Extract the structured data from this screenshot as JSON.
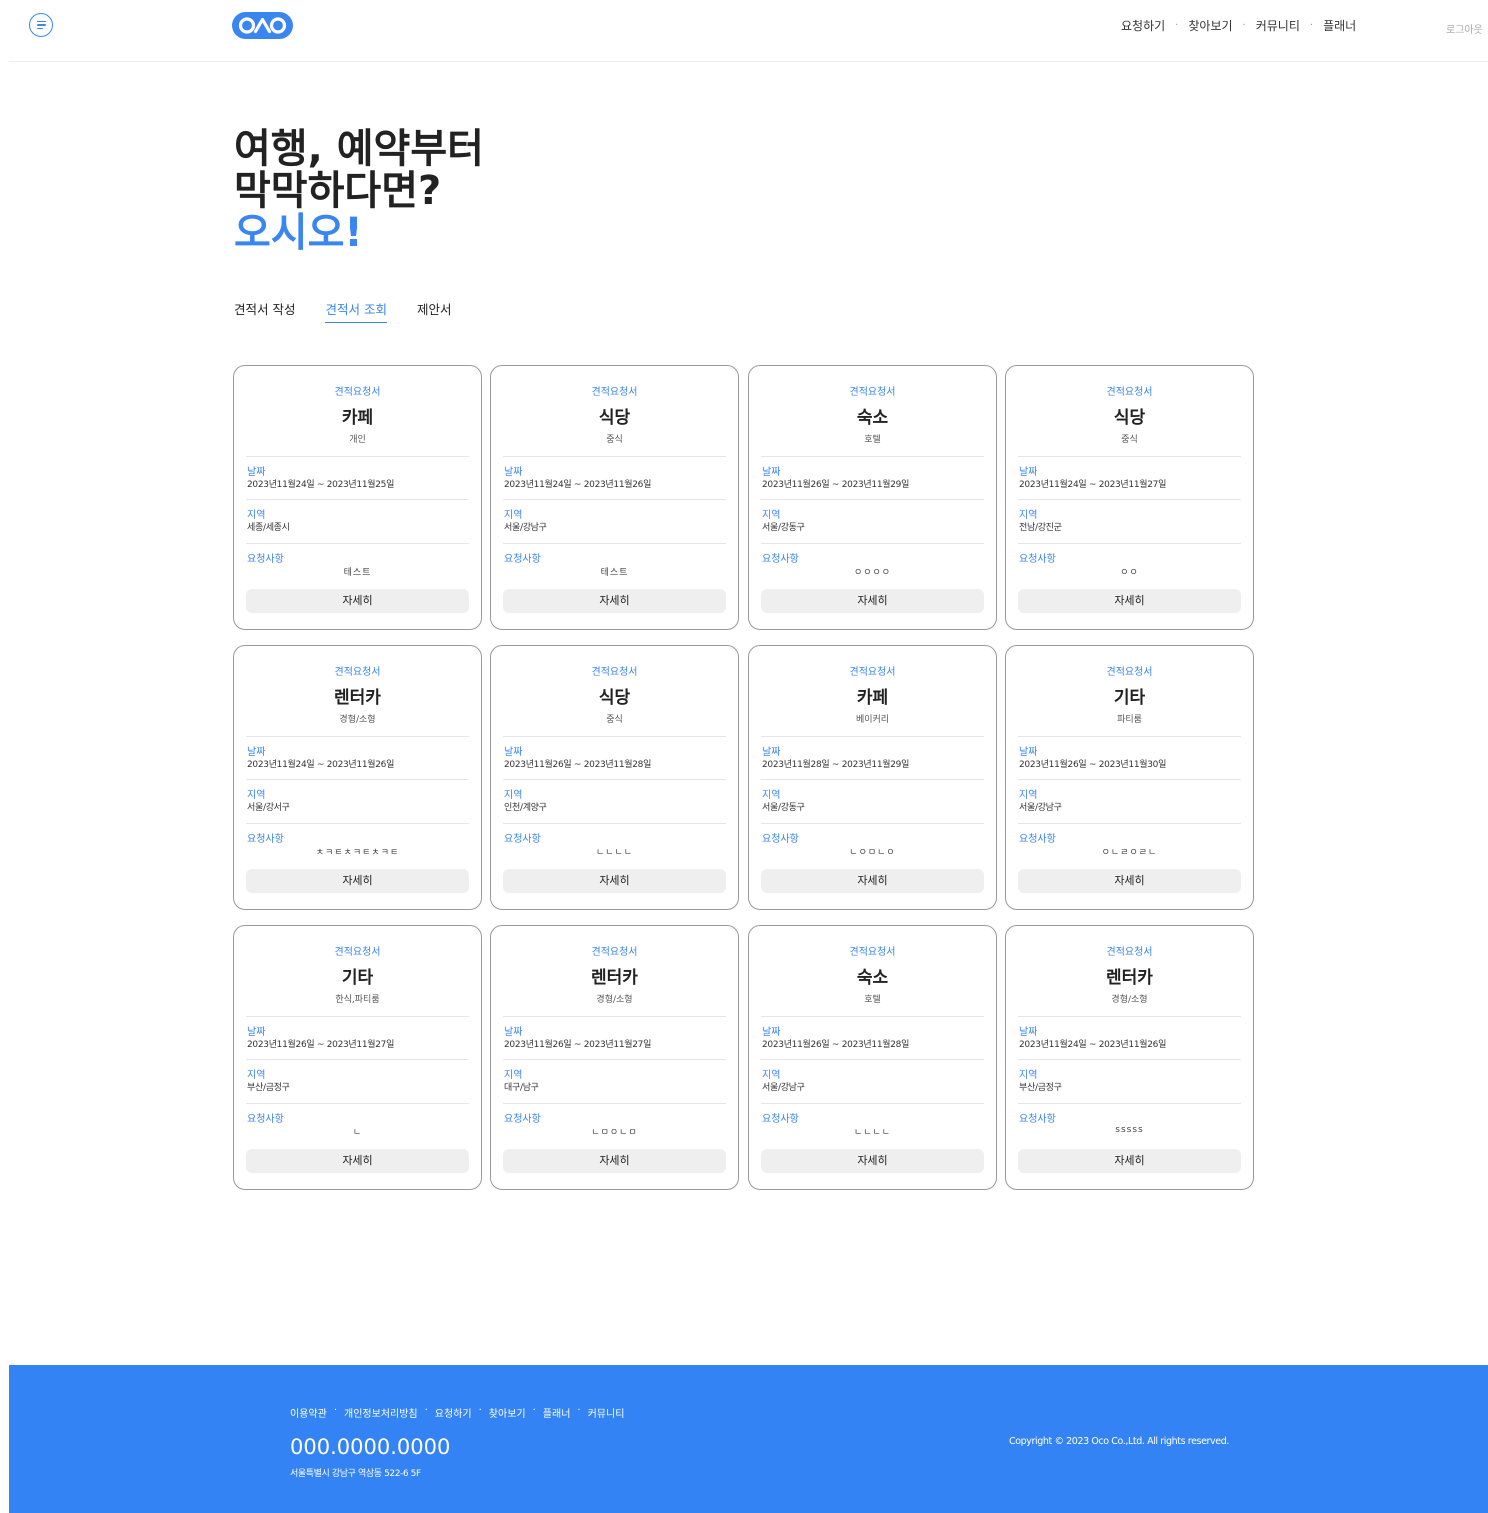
{
  "header": {
    "nav": [
      "요청하기",
      "찾아보기",
      "커뮤니티",
      "플래너"
    ],
    "nav_separator": "·",
    "logout": "로그아웃"
  },
  "hero": {
    "line1": "여행, 예약부터",
    "line2": "막막하다면?",
    "line3": "오시오!"
  },
  "tabs": [
    {
      "label": "견적서 작성",
      "active": false
    },
    {
      "label": "견적서 조회",
      "active": true
    },
    {
      "label": "제안서",
      "active": false
    }
  ],
  "card_labels": {
    "badge": "견적요청서",
    "date": "날짜",
    "region": "지역",
    "request": "요청사항",
    "button": "자세히"
  },
  "cards": [
    {
      "category": "카페",
      "sub": "개인",
      "date": "2023년11월24일 ~ 2023년11월25일",
      "region": "세종/세종시",
      "request": "테스트"
    },
    {
      "category": "식당",
      "sub": "중식",
      "date": "2023년11월24일 ~ 2023년11월26일",
      "region": "서울/강남구",
      "request": "테스트"
    },
    {
      "category": "숙소",
      "sub": "호텔",
      "date": "2023년11월26일 ~ 2023년11월29일",
      "region": "서울/강동구",
      "request": "ㅇㅇㅇㅇ"
    },
    {
      "category": "식당",
      "sub": "중식",
      "date": "2023년11월24일 ~ 2023년11월27일",
      "region": "전남/강진군",
      "request": "ㅇㅇ"
    },
    {
      "category": "렌터카",
      "sub": "경형/소형",
      "date": "2023년11월24일 ~ 2023년11월26일",
      "region": "서울/강서구",
      "request": "ㅊㅋㅌㅊㅋㅌㅊㅋㅌ"
    },
    {
      "category": "식당",
      "sub": "중식",
      "date": "2023년11월26일 ~ 2023년11월28일",
      "region": "인천/계양구",
      "request": "ㄴㄴㄴㄴ"
    },
    {
      "category": "카페",
      "sub": "베이커리",
      "date": "2023년11월28일 ~ 2023년11월29일",
      "region": "서울/강동구",
      "request": "ㄴㅇㅁㄴㅇ"
    },
    {
      "category": "기타",
      "sub": "파티룸",
      "date": "2023년11월26일 ~ 2023년11월30일",
      "region": "서울/강남구",
      "request": "ㅇㄴㄹㅇㄹㄴ"
    },
    {
      "category": "기타",
      "sub": "한식,파티룸",
      "date": "2023년11월26일 ~ 2023년11월27일",
      "region": "부산/금정구",
      "request": "ㄴ"
    },
    {
      "category": "렌터카",
      "sub": "경형/소형",
      "date": "2023년11월26일 ~ 2023년11월27일",
      "region": "대구/남구",
      "request": "ㄴㅁㅇㄴㅁ"
    },
    {
      "category": "숙소",
      "sub": "호텔",
      "date": "2023년11월26일 ~ 2023년11월28일",
      "region": "서울/강남구",
      "request": "ㄴㄴㄴㄴ"
    },
    {
      "category": "렌터카",
      "sub": "경형/소형",
      "date": "2023년11월24일 ~ 2023년11월26일",
      "region": "부산/금정구",
      "request": "sssss"
    }
  ],
  "footer": {
    "links": [
      "이용약관",
      "개인정보처리방침",
      "요청하기",
      "찾아보기",
      "플래너",
      "커뮤니티"
    ],
    "link_separator": "·",
    "phone": "000.0000.0000",
    "address": "서울특별시 강남구 역삼동 522-6 5F",
    "copyright": "Copyright © 2023 Oco Co.,Ltd. All rights reserved."
  },
  "colors": {
    "accent": "#3a86f0",
    "footer_bg": "#3483f5"
  },
  "icons": {
    "menu": "menu-icon",
    "logo": "oao-logo"
  }
}
